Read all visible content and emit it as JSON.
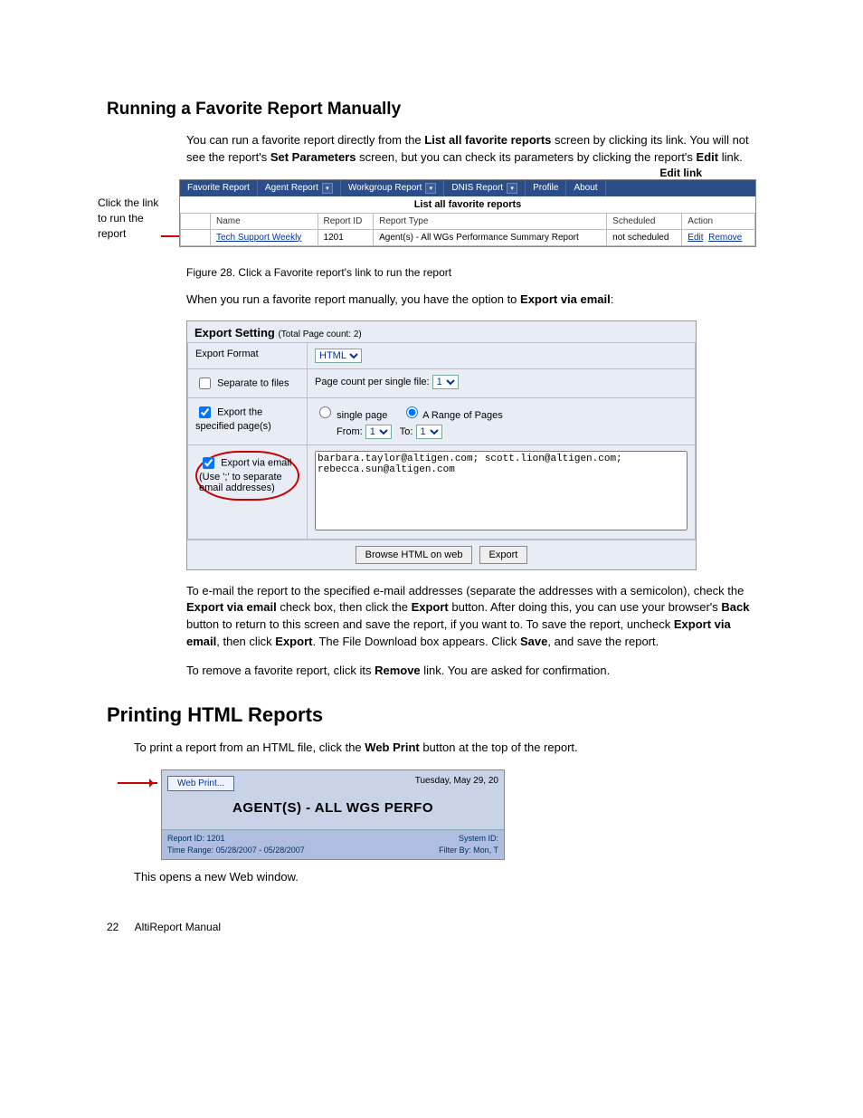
{
  "section1_heading": "Running a Favorite Report Manually",
  "section1_intro_1": "You can run a favorite report directly from the ",
  "section1_intro_b1": "List all favorite reports",
  "section1_intro_2": " screen by clicking its link. You will not see the report's ",
  "section1_intro_b2": "Set Parameters",
  "section1_intro_3": " screen, but you can check its parameters by clicking the report's ",
  "section1_intro_b3": "Edit",
  "section1_intro_4": " link.",
  "edit_link_label": "Edit link",
  "side_annot": "Click the link to run the report",
  "fig1": {
    "tabs": [
      "Favorite Report",
      "Agent Report",
      "Workgroup Report",
      "DNIS Report",
      "Profile",
      "About"
    ],
    "subhead": "List all favorite reports",
    "cols": [
      "Name",
      "Report ID",
      "Report Type",
      "Scheduled",
      "Action"
    ],
    "row": {
      "name": "Tech Support Weekly",
      "id": "1201",
      "type": "Agent(s) - All WGs Performance Summary Report",
      "sched": "not scheduled",
      "a_edit": "Edit",
      "a_remove": "Remove"
    }
  },
  "fig1_caption": "Figure 28.   Click a Favorite report's link to run the report",
  "section1_p2_1": "When you run a favorite report manually, you have the option to ",
  "section1_p2_b": "Export via email",
  "section1_p2_2": ":",
  "fig2": {
    "title": "Export Setting",
    "title_sub": "(Total Page count:    2)",
    "export_format_label": "Export Format",
    "export_format_value": "HTML",
    "separate_label": "Separate to files",
    "page_count_label": "Page count per single file:",
    "page_count_value": "1",
    "export_pages_label": "Export the specified page(s)",
    "single_page": "single page",
    "range_pages": "A Range of Pages",
    "from": "From:",
    "to": "To:",
    "from_v": "1",
    "to_v": "1",
    "email_label_1": "Export via email",
    "email_label_2": "(Use ';' to separate email addresses)",
    "email_text": "barbara.taylor@altigen.com; scott.lion@altigen.com; rebecca.sun@altigen.com",
    "btn_browse": "Browse HTML on web",
    "btn_export": "Export"
  },
  "section1_p3_1": "To e-mail the report to the specified e-mail addresses (separate the addresses with a semicolon), check the ",
  "section1_p3_b1": "Export via email",
  "section1_p3_2": " check box, then click the ",
  "section1_p3_b2": "Export",
  "section1_p3_3": " button. After doing this, you can use your browser's ",
  "section1_p3_b3": "Back",
  "section1_p3_4": " button to return to this screen and save the report, if you want to. To save the report, uncheck ",
  "section1_p3_b4": "Export via email",
  "section1_p3_5": ", then click ",
  "section1_p3_b5": "Export",
  "section1_p3_6": ". The File Download box appears. Click ",
  "section1_p3_b6": "Save",
  "section1_p3_7": ", and save the report.",
  "section1_p4_1": "To remove a favorite report, click its ",
  "section1_p4_b": "Remove",
  "section1_p4_2": " link. You are asked for confirmation.",
  "section2_heading": "Printing HTML Reports",
  "section2_p1_1": "To print a report from an HTML file, click the ",
  "section2_p1_b": "Web Print",
  "section2_p1_2": " button at the top of the report.",
  "fig3": {
    "btn": "Web Print...",
    "date": "Tuesday, May 29, 20",
    "title": "AGENT(S) - ALL WGS PERFO",
    "report_id": "Report ID: 1201",
    "time_range": "Time Range: 05/28/2007 - 05/28/2007",
    "system_id": "System ID:",
    "filter": "Filter By: Mon, T"
  },
  "section2_p2": "This opens a new Web window.",
  "footer_page": "22",
  "footer_title": "AltiReport Manual"
}
